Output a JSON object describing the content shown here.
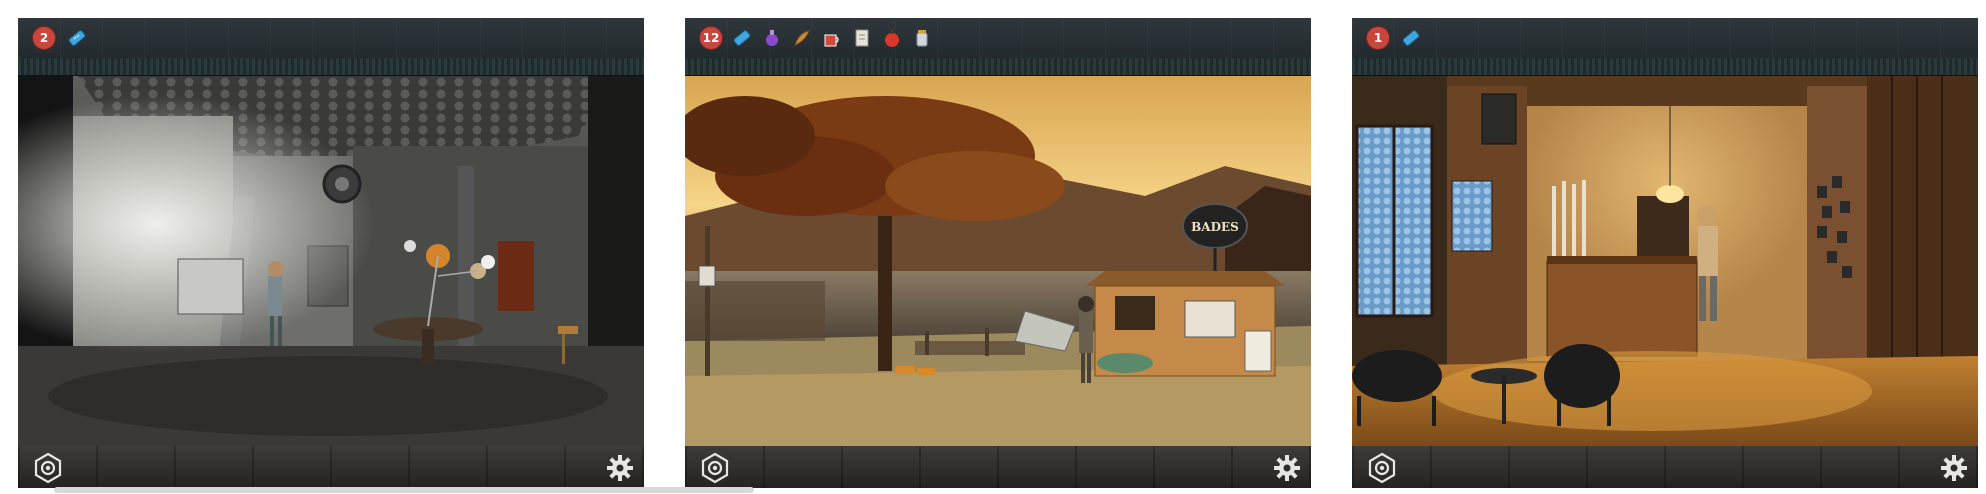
{
  "panels": [
    {
      "scene": "observatory",
      "inventory_count": "2",
      "items": [
        "ruler-icon"
      ]
    },
    {
      "scene": "lakeside-kiosk",
      "inventory_count": "12",
      "items": [
        "ruler-icon",
        "potion-icon",
        "feather-icon",
        "cup-icon",
        "paper-icon",
        "apple-icon",
        "jar-icon"
      ],
      "sign_text": "BADES"
    },
    {
      "scene": "hotel-lobby",
      "inventory_count": "1",
      "items": [
        "ruler-icon"
      ]
    }
  ],
  "colors": {
    "badge": "#c9463c",
    "topbar": "#2a3236",
    "bottombar": "#2e2c28"
  }
}
